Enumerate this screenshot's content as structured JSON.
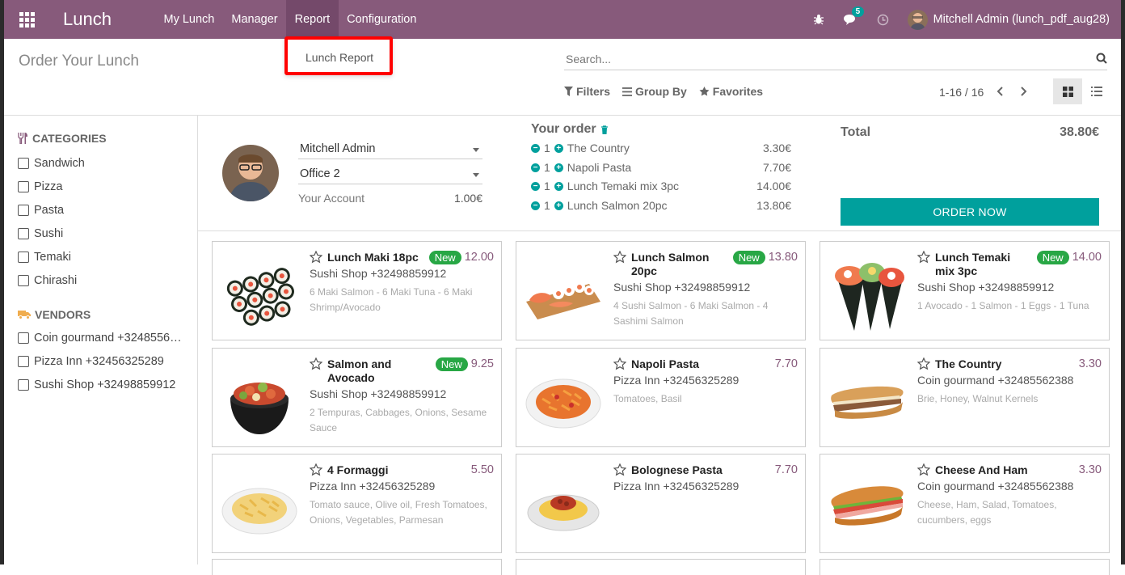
{
  "app": {
    "title": "Lunch"
  },
  "menu": [
    "My Lunch",
    "Manager",
    "Report",
    "Configuration"
  ],
  "dropdown": {
    "item": "Lunch Report"
  },
  "systray": {
    "messages_count": "5",
    "user_name": "Mitchell Admin (lunch_pdf_aug28)"
  },
  "control": {
    "title": "Order Your Lunch",
    "search_placeholder": "Search...",
    "filters": "Filters",
    "group_by": "Group By",
    "favorites": "Favorites",
    "pager": "1-16 / 16"
  },
  "sidebar": {
    "categories_title": "CATEGORIES",
    "categories": [
      "Sandwich",
      "Pizza",
      "Pasta",
      "Sushi",
      "Temaki",
      "Chirashi"
    ],
    "vendors_title": "VENDORS",
    "vendors": [
      "Coin gourmand +3248556…",
      "Pizza Inn +32456325289",
      "Sushi Shop +32498859912"
    ]
  },
  "order": {
    "user": "Mitchell Admin",
    "location": "Office 2",
    "account_label": "Your Account",
    "account_value": "1.00€",
    "your_order": "Your order",
    "lines": [
      {
        "qty": "1",
        "name": "The Country",
        "price": "3.30€"
      },
      {
        "qty": "1",
        "name": "Napoli Pasta",
        "price": "7.70€"
      },
      {
        "qty": "1",
        "name": "Lunch Temaki mix 3pc",
        "price": "14.00€"
      },
      {
        "qty": "1",
        "name": "Lunch Salmon 20pc",
        "price": "13.80€"
      }
    ],
    "total_label": "Total",
    "total_value": "38.80€",
    "order_now": "ORDER NOW"
  },
  "products": [
    {
      "name": "Lunch Maki 18pc",
      "new": "New",
      "price": "12.00",
      "vendor": "Sushi Shop +32498859912",
      "desc": "6 Maki Salmon - 6 Maki Tuna - 6 Maki Shrimp/Avocado",
      "icon": "maki-image"
    },
    {
      "name": "Lunch Salmon 20pc",
      "new": "New",
      "price": "13.80",
      "vendor": "Sushi Shop +32498859912",
      "desc": "4 Sushi Salmon - 6 Maki Salmon - 4 Sashimi Salmon",
      "icon": "salmon-platter-image"
    },
    {
      "name": "Lunch Temaki mix 3pc",
      "new": "New",
      "price": "14.00",
      "vendor": "Sushi Shop +32498859912",
      "desc": "1 Avocado - 1 Salmon - 1 Eggs - 1 Tuna",
      "icon": "temaki-image"
    },
    {
      "name": "Salmon and Avocado",
      "new": "New",
      "price": "9.25",
      "vendor": "Sushi Shop +32498859912",
      "desc": "2 Tempuras, Cabbages, Onions, Sesame Sauce",
      "icon": "poke-bowl-image"
    },
    {
      "name": "Napoli Pasta",
      "new": "",
      "price": "7.70",
      "vendor": "Pizza Inn +32456325289",
      "desc": "Tomatoes, Basil",
      "icon": "napoli-pasta-image"
    },
    {
      "name": "The Country",
      "new": "",
      "price": "3.30",
      "vendor": "Coin gourmand +32485562388",
      "desc": "Brie, Honey, Walnut Kernels",
      "icon": "country-sandwich-image"
    },
    {
      "name": "4 Formaggi",
      "new": "",
      "price": "5.50",
      "vendor": "Pizza Inn +32456325289",
      "desc": "Tomato sauce, Olive oil, Fresh Tomatoes, Onions, Vegetables, Parmesan",
      "icon": "formaggi-pasta-image"
    },
    {
      "name": "Bolognese Pasta",
      "new": "",
      "price": "7.70",
      "vendor": "Pizza Inn +32456325289",
      "desc": "",
      "icon": "bolognese-pasta-image"
    },
    {
      "name": "Cheese And Ham",
      "new": "",
      "price": "3.30",
      "vendor": "Coin gourmand +32485562388",
      "desc": "Cheese, Ham, Salad, Tomatoes, cucumbers, eggs",
      "icon": "cheese-ham-sandwich-image"
    }
  ],
  "colors": {
    "brand": "#875a7b",
    "accent": "#00a09d",
    "new_badge": "#28a745"
  }
}
